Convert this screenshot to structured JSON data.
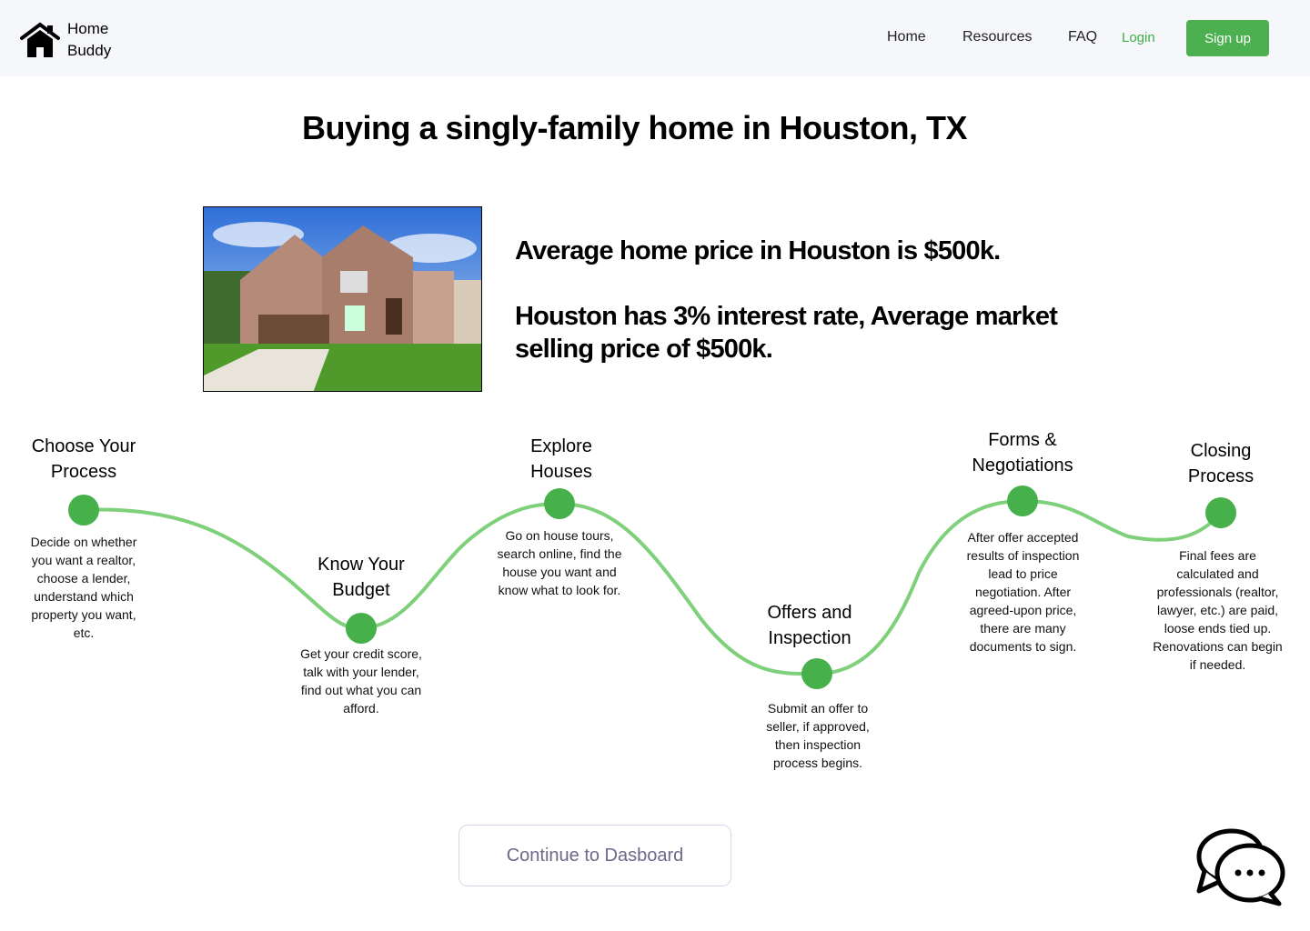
{
  "nav": {
    "logo_line1": "Home",
    "logo_line2": "Buddy",
    "links": [
      "Home",
      "Resources",
      "FAQ"
    ],
    "login": "Login",
    "signup": "Sign up"
  },
  "page_title": "Buying a singly-family home in Houston, TX",
  "stats": {
    "line1": "Average home price in Houston is $500k.",
    "line2": "Houston has 3% interest rate, Average market selling price of $500k."
  },
  "colors": {
    "accent": "#46b04a",
    "curve": "#7fd07a",
    "nav_bg": "#f6f7fb"
  },
  "steps": [
    {
      "title": "Choose Your Process",
      "desc": "Decide on whether you want a realtor, choose a lender, understand which property you want, etc."
    },
    {
      "title": "Know Your Budget",
      "desc": "Get your credit score, talk with your lender, find out what you can afford."
    },
    {
      "title": "Explore Houses",
      "desc": "Go on house tours, search online, find the house you want and know what to look for."
    },
    {
      "title": "Offers and Inspection",
      "desc": "Submit an offer to seller, if approved, then inspection process begins."
    },
    {
      "title": "Forms & Negotiations",
      "desc": "After offer accepted results of inspection lead to price negotiation. After agreed-upon price, there are many documents  to sign."
    },
    {
      "title": "Closing Process",
      "desc": "Final fees are calculated and professionals (realtor, lawyer, etc.) are paid, loose ends tied up. Renovations can begin if needed."
    }
  ],
  "cta": "Continue to Dasboard",
  "icons": {
    "logo": "house-icon",
    "chat": "chat-bubbles-icon"
  }
}
